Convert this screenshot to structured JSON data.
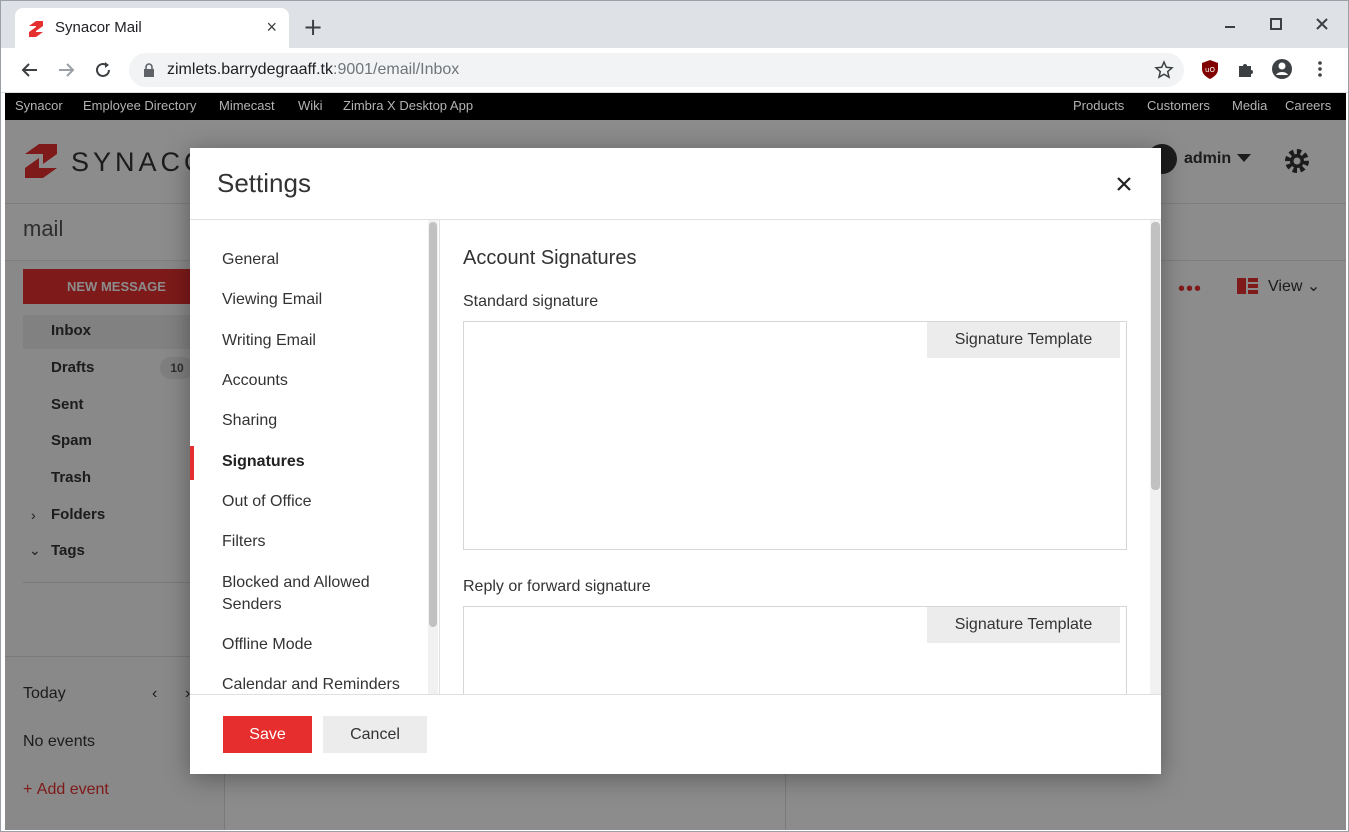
{
  "browser": {
    "tab_title": "Synacor Mail",
    "tab_close": "×",
    "new_tab": "+",
    "url_host": "zimlets.barrydegraaff.tk",
    "url_path": ":9001/email/Inbox"
  },
  "linkbar": {
    "left": [
      "Synacor",
      "Employee Directory",
      "Mimecast",
      "Wiki",
      "Zimbra X Desktop App"
    ],
    "right": [
      "Products",
      "Customers",
      "Media",
      "Careers"
    ]
  },
  "app": {
    "logo_text": "SYNACO",
    "user": "admin",
    "section_title": "mail",
    "new_message": "NEW MESSAGE",
    "folders": {
      "inbox": "Inbox",
      "drafts": "Drafts",
      "drafts_count": "10",
      "sent": "Sent",
      "spam": "Spam",
      "trash": "Trash",
      "folders": "Folders",
      "tags": "Tags"
    },
    "calendar": {
      "today": "Today",
      "no_events": "No events",
      "add_event": "Add event"
    },
    "list": {
      "more": "•••",
      "view": "View"
    }
  },
  "modal": {
    "title": "Settings",
    "nav": [
      "General",
      "Viewing Email",
      "Writing Email",
      "Accounts",
      "Sharing",
      "Signatures",
      "Out of Office",
      "Filters",
      "Blocked and Allowed Senders",
      "Offline Mode",
      "Calendar and Reminders"
    ],
    "active_nav": "Signatures",
    "content": {
      "title": "Account Signatures",
      "standard_label": "Standard signature",
      "reply_label": "Reply or forward signature",
      "template_button": "Signature Template"
    },
    "save": "Save",
    "cancel": "Cancel"
  },
  "colors": {
    "accent": "#e63030",
    "linkbar_bg": "#000000"
  }
}
